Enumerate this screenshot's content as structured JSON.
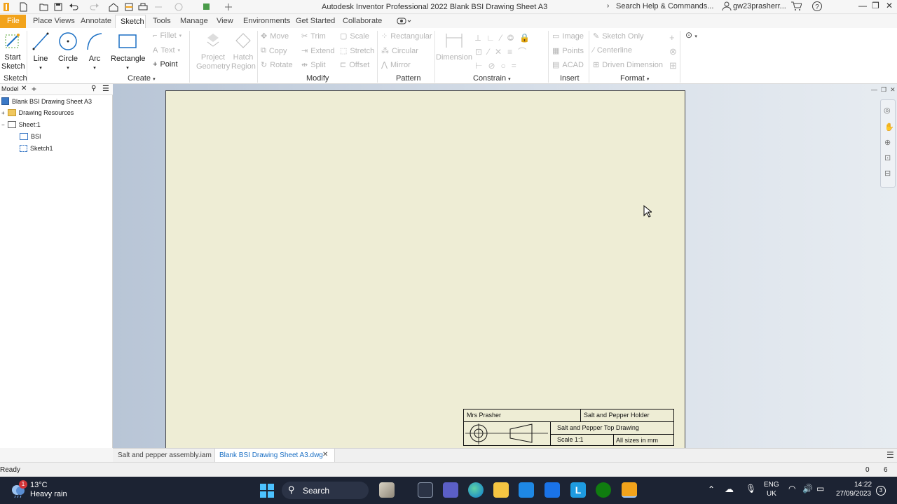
{
  "app": {
    "title": "Autodesk Inventor Professional 2022   Blank BSI Drawing Sheet A3",
    "search_label": "Search Help & Commands...",
    "user": "gw23prasherr..."
  },
  "tabs": [
    {
      "label": "File"
    },
    {
      "label": "Place Views"
    },
    {
      "label": "Annotate"
    },
    {
      "label": "Sketch"
    },
    {
      "label": "Tools"
    },
    {
      "label": "Manage"
    },
    {
      "label": "View"
    },
    {
      "label": "Environments"
    },
    {
      "label": "Get Started"
    },
    {
      "label": "Collaborate"
    }
  ],
  "ribbon": {
    "sketch": {
      "start_sketch": "Start\nSketch",
      "group": "Sketch"
    },
    "create": {
      "line": "Line",
      "circle": "Circle",
      "arc": "Arc",
      "rectangle": "Rectangle",
      "fillet": "Fillet",
      "text": "Text",
      "point": "Point",
      "group": "Create"
    },
    "geometry": {
      "project_geometry": "Project\nGeometry",
      "hatch_region": "Hatch\nRegion"
    },
    "modify": {
      "move": "Move",
      "trim": "Trim",
      "scale": "Scale",
      "copy": "Copy",
      "extend": "Extend",
      "stretch": "Stretch",
      "rotate": "Rotate",
      "split": "Split",
      "offset": "Offset",
      "group": "Modify"
    },
    "pattern": {
      "rectangular": "Rectangular",
      "circular": "Circular",
      "mirror": "Mirror",
      "group": "Pattern"
    },
    "constrain": {
      "dimension": "Dimension",
      "group": "Constrain"
    },
    "insert": {
      "image": "Image",
      "points": "Points",
      "acad": "ACAD",
      "group": "Insert"
    },
    "format": {
      "sketch_only": "Sketch Only",
      "centerline": "Centerline",
      "driven_dimension": "Driven Dimension",
      "group": "Format"
    }
  },
  "browser": {
    "tab": "Model",
    "items": [
      {
        "label": "Blank BSI Drawing Sheet A3"
      },
      {
        "label": "Drawing Resources"
      },
      {
        "label": "Sheet:1"
      },
      {
        "label": "BSI"
      },
      {
        "label": "Sketch1"
      }
    ]
  },
  "title_block": {
    "author": "Mrs Prasher",
    "part": "Salt and Pepper Holder",
    "drawing": "Salt and Pepper Top Drawing",
    "scale": "Scale 1:1",
    "units": "All sizes in mm"
  },
  "doc_tabs": [
    {
      "label": "Salt and pepper assembly.iam"
    },
    {
      "label": "Blank BSI Drawing Sheet A3.dwg"
    }
  ],
  "status": {
    "text": "Ready",
    "count_a": "0",
    "count_b": "6"
  },
  "taskbar": {
    "weather_temp": "13°C",
    "weather_desc": "Heavy rain",
    "weather_badge": "1",
    "search": "Search",
    "lang": "ENG",
    "region": "UK",
    "time": "14:22",
    "date": "27/09/2023",
    "notif": "3"
  },
  "colors": {
    "accent": "#f2a31b",
    "sheet": "#eeedd5",
    "taskbar": "#1c2333",
    "active_tab_text": "#1a6fc4"
  }
}
